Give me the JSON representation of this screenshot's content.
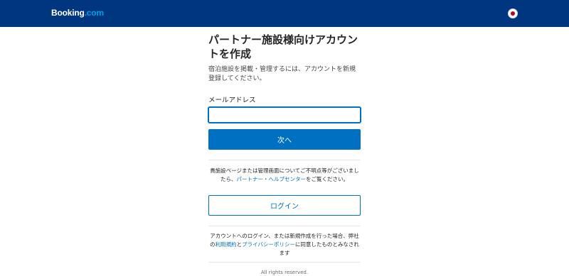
{
  "header": {
    "logo_main": "Booking",
    "logo_suffix": ".com",
    "language_icon": "japan-flag-icon"
  },
  "main": {
    "title": "パートナー施設様向けアカウントを作成",
    "subtitle": "宿泊施設を掲載・管理するには、アカウントを新規登録してください。",
    "email_label": "メールアドレス",
    "email_value": "",
    "email_placeholder": "",
    "next_button": "次へ",
    "help_text_before": "貴施設ページまたは管理画面についてご不明点等がございましたら、",
    "help_link": "パートナー・ヘルプセンター",
    "help_text_after": "をご覧ください。",
    "login_button": "ログイン",
    "terms_before": "アカウントへのログイン、または新規作成を行った場合、弊社の",
    "terms_link": "利用規約",
    "terms_middle": "と",
    "privacy_link": "プライバシーポリシー",
    "terms_after": "に同意したものとみなされます",
    "footer": "All rights reserved."
  },
  "colors": {
    "header_bg": "#003580",
    "accent": "#0071c2",
    "logo_dotcom": "#009fe3"
  }
}
